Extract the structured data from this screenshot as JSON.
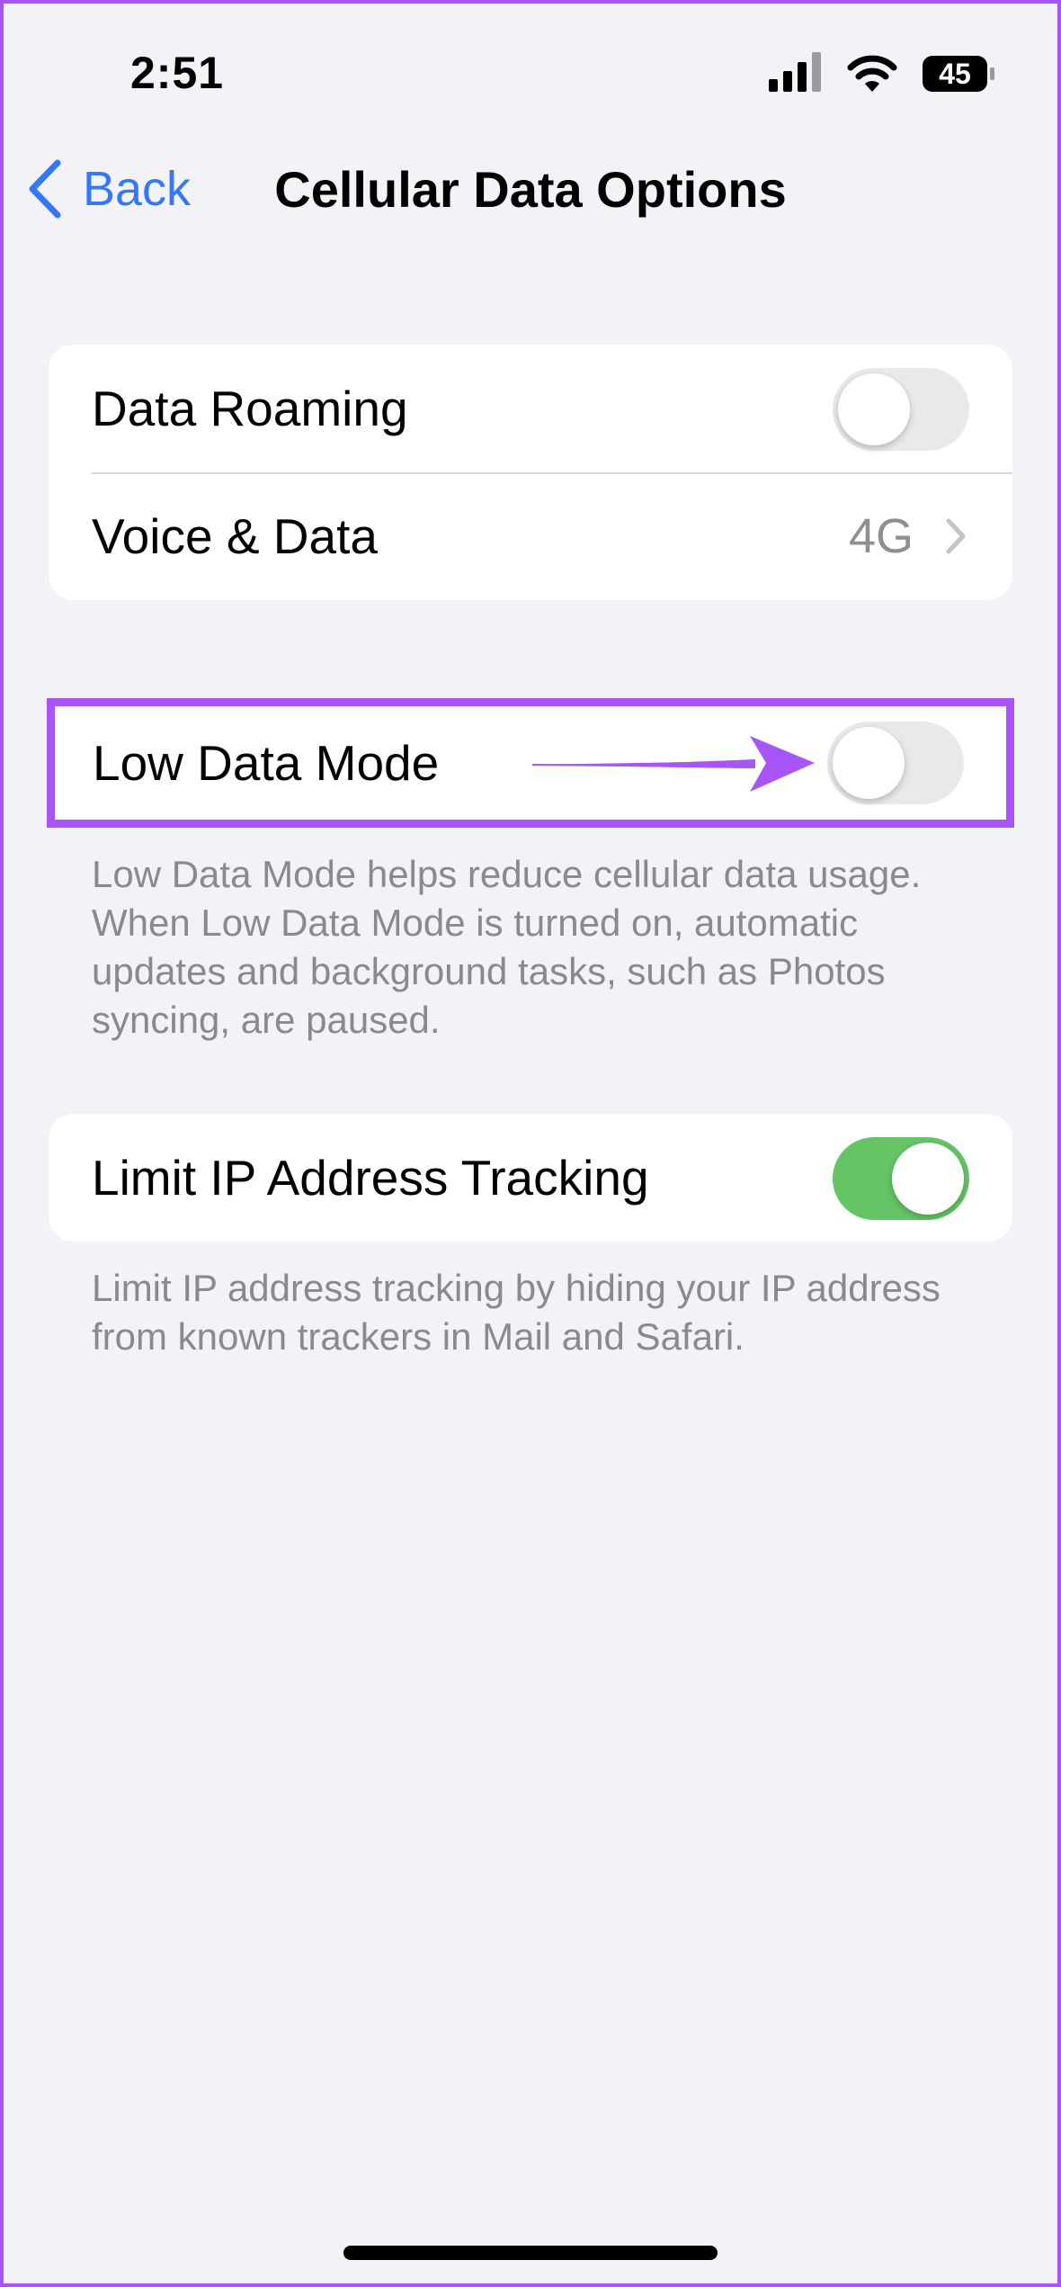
{
  "status_bar": {
    "time": "2:51",
    "battery_level": "45",
    "icons": [
      "cellular-signal-icon",
      "wifi-icon",
      "battery-icon"
    ]
  },
  "nav": {
    "back_label": "Back",
    "title": "Cellular Data Options"
  },
  "group1": {
    "data_roaming_label": "Data Roaming",
    "data_roaming_on": false,
    "voice_data_label": "Voice & Data",
    "voice_data_value": "4G"
  },
  "low_data": {
    "label": "Low Data Mode",
    "on": false,
    "footer": "Low Data Mode helps reduce cellular data usage. When Low Data Mode is turned on, automatic updates and background tasks, such as Photos syncing, are paused."
  },
  "limit_ip": {
    "label": "Limit IP Address Tracking",
    "on": true,
    "footer": "Limit IP address tracking by hiding your IP address from known trackers in Mail and Safari."
  },
  "colors": {
    "accent": "#3478f6",
    "toggle_on": "#65c466",
    "highlight": "#a855f7",
    "background": "#f2f2f7"
  }
}
